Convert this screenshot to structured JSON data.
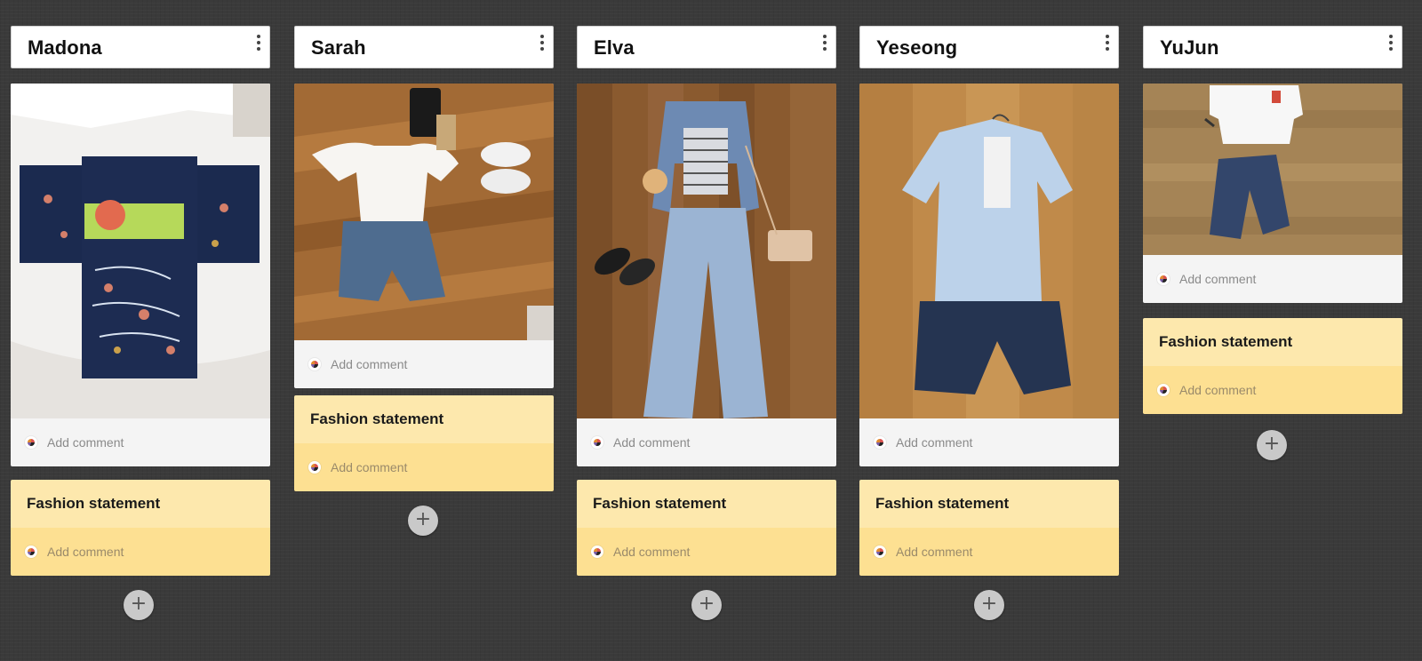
{
  "board": {
    "columns": [
      {
        "title": "Madona",
        "photo_comment_placeholder": "Add comment",
        "note_title": "Fashion statement",
        "note_comment_placeholder": "Add comment",
        "add_label": "+"
      },
      {
        "title": "Sarah",
        "photo_comment_placeholder": "Add comment",
        "note_title": "Fashion statement",
        "note_comment_placeholder": "Add comment",
        "add_label": "+"
      },
      {
        "title": "Elva",
        "photo_comment_placeholder": "Add comment",
        "note_title": "Fashion statement",
        "note_comment_placeholder": "Add comment",
        "add_label": "+"
      },
      {
        "title": "Yeseong",
        "photo_comment_placeholder": "Add comment",
        "note_title": "Fashion statement",
        "note_comment_placeholder": "Add comment",
        "add_label": "+"
      },
      {
        "title": "YuJun",
        "photo_comment_placeholder": "Add comment",
        "note_title": "Fashion statement",
        "note_comment_placeholder": "Add comment",
        "add_label": "+"
      }
    ]
  },
  "icons": {
    "column_menu": "more-vertical-icon",
    "add": "plus-icon",
    "avatar": "user-avatar-icon"
  },
  "colors": {
    "board_background": "#3a3a3a",
    "header_background": "#ffffff",
    "comment_background": "#f4f4f4",
    "note_header": "#fde8ad",
    "note_footer": "#fde092",
    "add_button": "#c9c9c9"
  }
}
